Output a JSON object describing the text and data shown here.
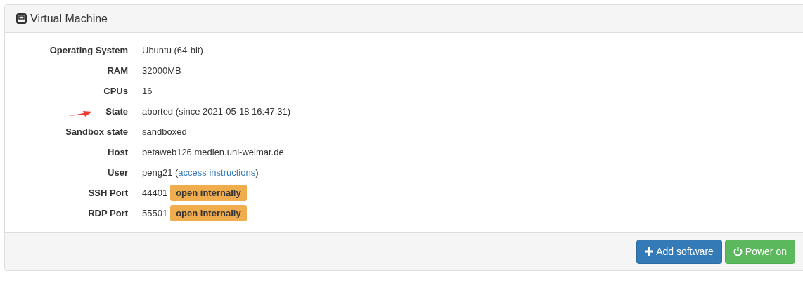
{
  "panel": {
    "title": "Virtual Machine"
  },
  "rows": [
    {
      "label": "Operating System",
      "value": "Ubuntu (64-bit)"
    },
    {
      "label": "RAM",
      "value": "32000MB"
    },
    {
      "label": "CPUs",
      "value": "16"
    },
    {
      "label": "State",
      "value": "aborted (since 2021-05-18 16:47:31)",
      "annotated": true
    },
    {
      "label": "Sandbox state",
      "value": "sandboxed"
    },
    {
      "label": "Host",
      "value": "betaweb126.medien.uni-weimar.de"
    },
    {
      "label": "User",
      "value": "peng21 (",
      "link": "access instructions",
      "suffix": ")"
    },
    {
      "label": "SSH Port",
      "value": "44401",
      "badge": "open internally"
    },
    {
      "label": "RDP Port",
      "value": "55501",
      "badge": "open internally"
    }
  ],
  "buttons": [
    {
      "label": "Add software",
      "kind": "primary"
    },
    {
      "label": "Power on",
      "kind": "success"
    }
  ]
}
